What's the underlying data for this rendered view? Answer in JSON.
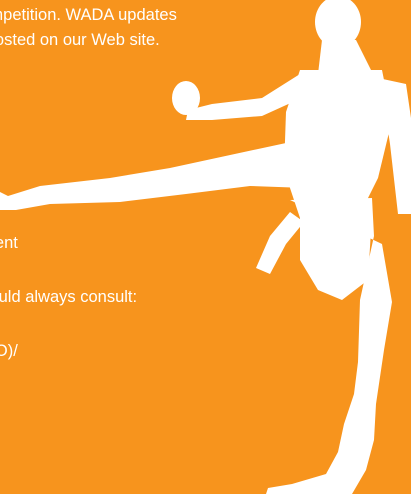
{
  "text_lines": [
    "competition. WADA updates",
    "e posted on our Web site.",
    "ement",
    "should always consult:",
    "ADO)/"
  ],
  "colors": {
    "background": "#f7941d",
    "text": "#ffffff",
    "silhouette": "#ffffff"
  },
  "illustration": "martial-artist-kick-silhouette"
}
